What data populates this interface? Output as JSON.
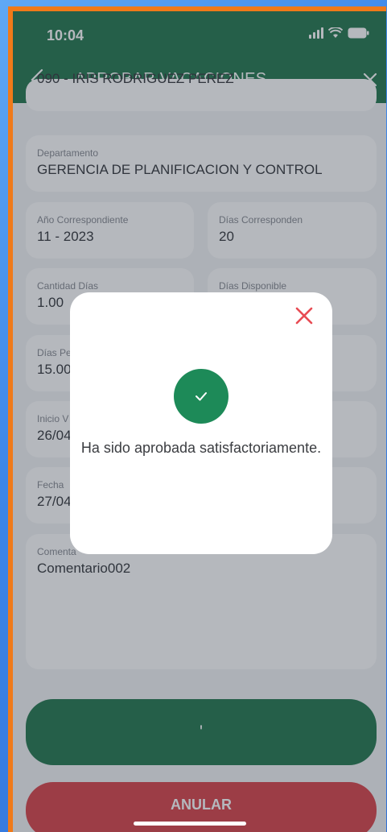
{
  "status_bar": {
    "time": "10:04"
  },
  "header": {
    "title": "APROBAR VACACIONES",
    "trailing_text": ","
  },
  "fields": {
    "employee": {
      "value": "090 - IRIS RODRIGUEZ PEREZ"
    },
    "department": {
      "label": "Departamento",
      "value": "GERENCIA DE PLANIFICACION Y CONTROL"
    },
    "year": {
      "label": "Año Correspondiente",
      "value": "11 - 2023"
    },
    "days_due": {
      "label": "Días Corresponden",
      "value": "20"
    },
    "days_count": {
      "label": "Cantidad Días",
      "value": "1.00"
    },
    "days_available": {
      "label": "Días Disponible",
      "value": ""
    },
    "days_pending": {
      "label": "Días Pe",
      "value": "15.00"
    },
    "start": {
      "label": "Inicio V",
      "value": "26/04"
    },
    "end": {
      "label": "Fecha",
      "value": "27/04"
    },
    "comment": {
      "label": "Comenta",
      "value": "Comentario002"
    }
  },
  "buttons": {
    "primary_label": "'",
    "cancel_label": "ANULAR"
  },
  "modal": {
    "message": "Ha sido aprobada satisfactoriamente."
  },
  "colors": {
    "primary": "#106b3f",
    "danger": "#d6323a",
    "success": "#1d8a58",
    "close": "#e84b53"
  },
  "icons": {
    "back": "chevron-left-icon",
    "close": "close-icon",
    "check": "check-icon"
  }
}
